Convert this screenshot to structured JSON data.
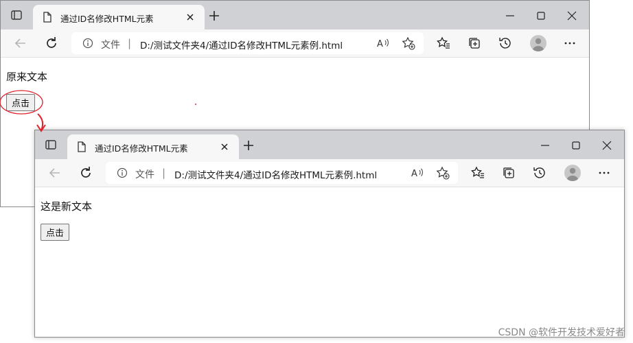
{
  "before_window": {
    "tab_title": "通过ID名修改HTML元素",
    "address_label": "文件",
    "address_separator": "|",
    "address_url": "D:/测试文件夹4/通过ID名修改HTML元素例.html",
    "page_text": "原来文本",
    "button_label": "点击"
  },
  "after_window": {
    "tab_title": "通过ID名修改HTML元素",
    "address_label": "文件",
    "address_separator": "|",
    "address_url": "D:/测试文件夹4/通过ID名修改HTML元素例.html",
    "page_text": "这是新文本",
    "button_label": "点击"
  },
  "annotation": {
    "color": "#e0202a",
    "marks": [
      "circle-around-button",
      "arrow-to-result-window"
    ]
  },
  "watermark": "CSDN @软件开发技术爱好者",
  "icons": [
    "tab-actions-icon",
    "page-icon",
    "close-tab-icon",
    "new-tab-icon",
    "minimize-icon",
    "maximize-icon",
    "close-window-icon",
    "back-icon",
    "reload-icon",
    "info-icon",
    "read-aloud-icon",
    "add-favorite-icon",
    "favorites-icon",
    "collections-icon",
    "history-icon",
    "profile-avatar",
    "more-icon"
  ]
}
